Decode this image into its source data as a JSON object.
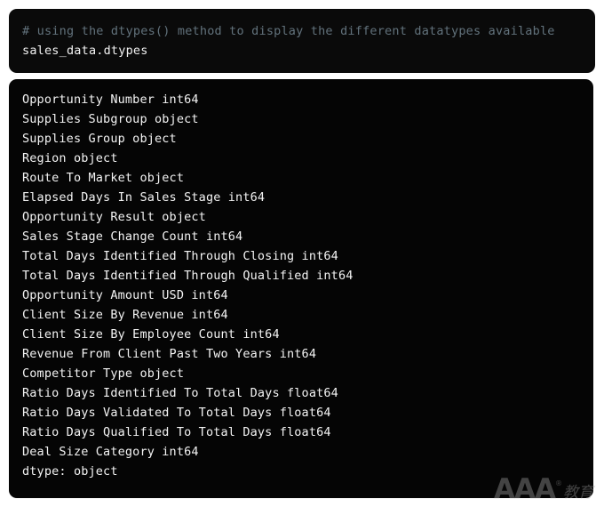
{
  "input_cell": {
    "comment": "# using the dtypes() method to display the different datatypes available",
    "statement": "sales_data.dtypes"
  },
  "output_cell": {
    "lines": [
      "Opportunity Number int64",
      "Supplies Subgroup object",
      "Supplies Group object",
      "Region object",
      "Route To Market object",
      "Elapsed Days In Sales Stage int64",
      "Opportunity Result object",
      "Sales Stage Change Count int64",
      "Total Days Identified Through Closing int64",
      "Total Days Identified Through Qualified int64",
      "Opportunity Amount USD int64",
      "Client Size By Revenue int64",
      "Client Size By Employee Count int64",
      "Revenue From Client Past Two Years int64",
      "Competitor Type object",
      "Ratio Days Identified To Total Days float64",
      "Ratio Days Validated To Total Days float64",
      "Ratio Days Qualified To Total Days float64",
      "Deal Size Category int64"
    ],
    "summary": "dtype: object"
  },
  "watermark": {
    "brand": "AAA",
    "registered": "®",
    "suffix": "教育"
  },
  "colors": {
    "page_background": "#ffffff",
    "cell_background": "#0a0a0a",
    "output_background": "#050505",
    "code_text": "#f2f2f2",
    "comment_text": "#62727c",
    "output_text": "#f4f4f4",
    "watermark": "#9a9a9a"
  }
}
